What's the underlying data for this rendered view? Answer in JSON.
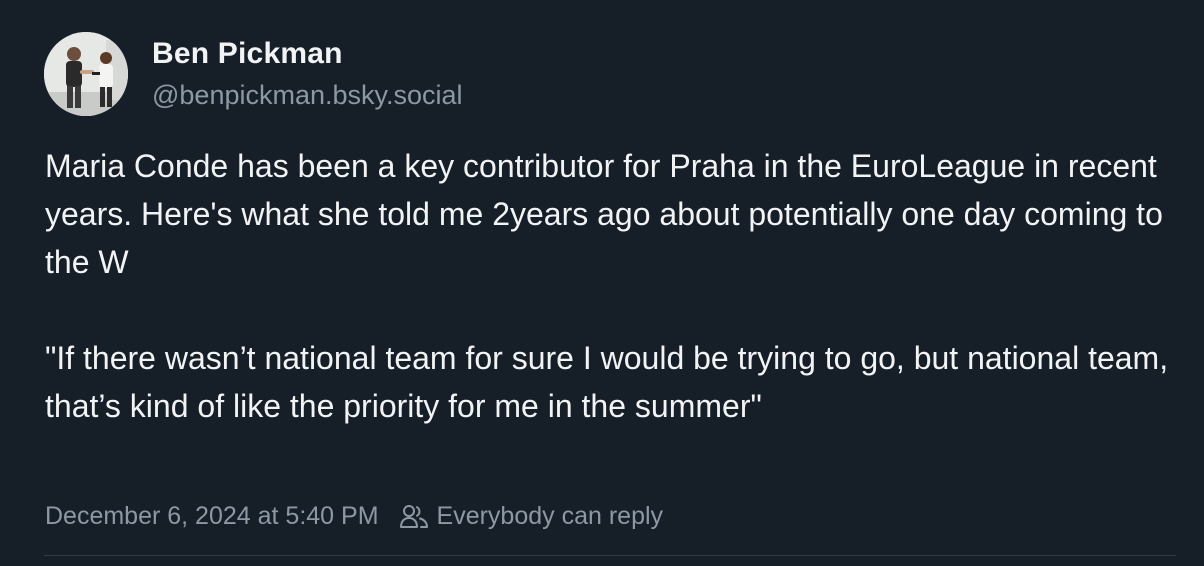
{
  "author": {
    "display_name": "Ben Pickman",
    "handle": "@benpickman.bsky.social",
    "avatar_icon": "user-avatar-photo"
  },
  "post": {
    "paragraphs": [
      "Maria Conde has been a key contributor for Praha in the EuroLeague in recent years. Here's what she told me 2years ago about potentially one day coming to the W",
      "\"If there wasn’t national team for sure I would be trying to go, but national team, that’s kind of like the priority for me in the summer\""
    ],
    "timestamp": "December 6, 2024 at 5:40 PM",
    "reply_setting": "Everybody can reply",
    "reply_icon": "people-icon"
  },
  "colors": {
    "background": "#161e27",
    "text": "#f1f3f5",
    "muted": "#8d98a6",
    "divider": "#2e3a48"
  }
}
